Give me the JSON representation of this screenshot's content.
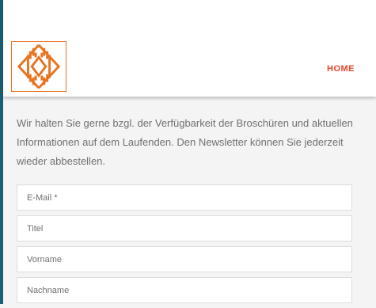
{
  "header": {
    "logo_name": "diamond-stripes-logo",
    "nav": {
      "home_label": "HOME"
    }
  },
  "colors": {
    "accent": "#e8452c",
    "logo": "#e8731f",
    "edge_bar": "#1b5f75",
    "background": "#f4f4f4"
  },
  "newsletter": {
    "intro": "Wir halten Sie gerne bzgl. der Verfügbarkeit der Broschüren und aktuellen Informationen auf dem Laufenden. Den Newsletter können Sie jederzeit wieder abbestellen.",
    "fields": {
      "email_placeholder": "E-Mail *",
      "title_placeholder": "Titel",
      "firstname_placeholder": "Vorname",
      "lastname_placeholder": "Nachname"
    }
  }
}
